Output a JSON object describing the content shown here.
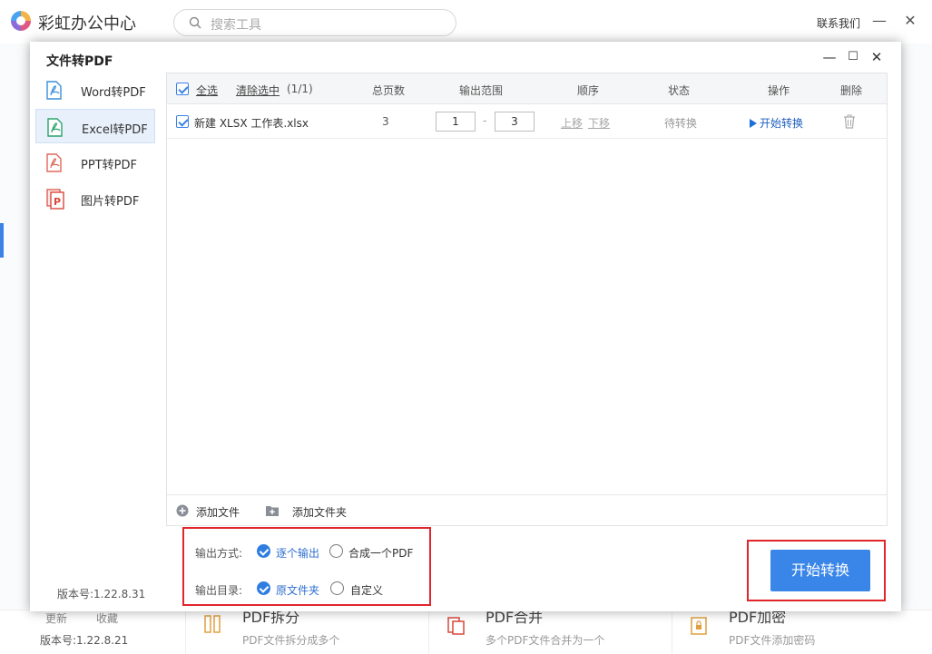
{
  "app": {
    "title": "彩虹办公中心",
    "search_placeholder": "搜索工具",
    "contact": "联系我们",
    "min_icon": "—",
    "close_icon": "✕",
    "version": "版本号:1.22.8.21",
    "bottom_links": [
      "更新",
      "收藏"
    ],
    "cards": [
      {
        "title": "PDF拆分",
        "desc": "PDF文件拆分成多个"
      },
      {
        "title": "PDF合并",
        "desc": "多个PDF文件合并为一个"
      },
      {
        "title": "PDF加密",
        "desc": "PDF文件添加密码"
      }
    ]
  },
  "dialog": {
    "title": "文件转PDF",
    "min_icon": "—",
    "max_icon": "☐",
    "close_icon": "✕",
    "version": "版本号:1.22.8.31",
    "sidebar": [
      {
        "label": "Word转PDF",
        "active": false,
        "color": "#3a8fd8"
      },
      {
        "label": "Excel转PDF",
        "active": true,
        "color": "#2aa36b"
      },
      {
        "label": "PPT转PDF",
        "active": false,
        "color": "#e0685a"
      },
      {
        "label": "图片转PDF",
        "active": false,
        "color": "#d9483b"
      }
    ],
    "table": {
      "select_all": "全选",
      "clear_selected": "清除选中",
      "count": "(1/1)",
      "headers": {
        "pages": "总页数",
        "range": "输出范围",
        "order": "顺序",
        "status": "状态",
        "action": "操作",
        "delete": "删除"
      },
      "rows": [
        {
          "filename": "新建 XLSX 工作表.xlsx",
          "pages": "3",
          "range_from": "1",
          "range_sep": "-",
          "range_to": "3",
          "move_up": "上移",
          "move_down": "下移",
          "status": "待转换",
          "action": "开始转换"
        }
      ]
    },
    "footer": {
      "add_file": "添加文件",
      "add_folder": "添加文件夹"
    },
    "options": {
      "output_mode_label": "输出方式:",
      "mode_one_by_one": "逐个输出",
      "mode_merge": "合成一个PDF",
      "output_dir_label": "输出目录:",
      "dir_original": "原文件夹",
      "dir_custom": "自定义"
    },
    "start_button": "开始转换"
  }
}
